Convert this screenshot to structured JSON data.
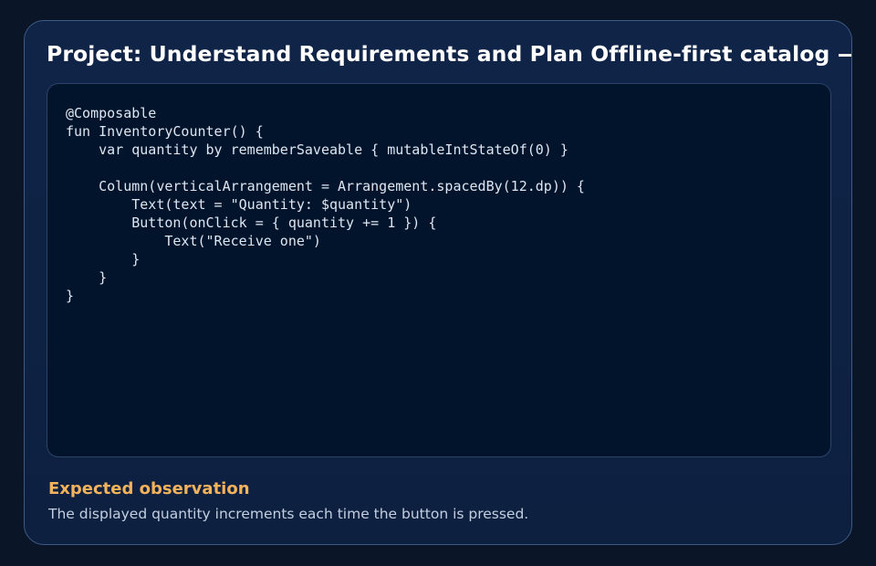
{
  "card": {
    "title": "Project: Understand Requirements and Plan Offline-first catalog — v",
    "code": "@Composable\nfun InventoryCounter() {\n    var quantity by rememberSaveable { mutableIntStateOf(0) }\n\n    Column(verticalArrangement = Arrangement.spacedBy(12.dp)) {\n        Text(text = \"Quantity: $quantity\")\n        Button(onClick = { quantity += 1 }) {\n            Text(\"Receive one\")\n        }\n    }\n}",
    "observation_heading": "Expected observation",
    "observation_text": "The displayed quantity increments each time the button is pressed."
  },
  "colors": {
    "background": "#0a1628",
    "panel": "#0f2447",
    "code_background": "#02142b",
    "accent": "#f4b25c",
    "text": "#ffffff"
  }
}
